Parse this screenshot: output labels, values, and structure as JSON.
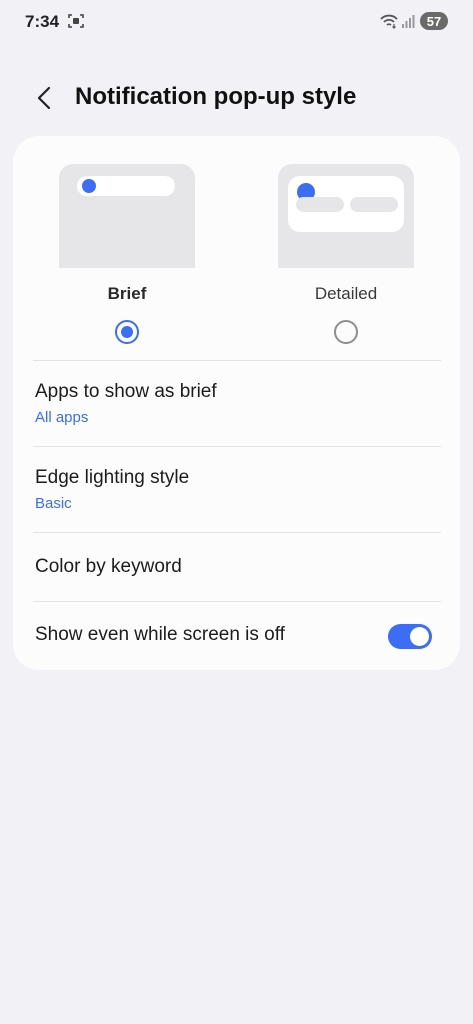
{
  "status_bar": {
    "time": "7:34",
    "battery": "57"
  },
  "header": {
    "title": "Notification pop-up style"
  },
  "styles": [
    {
      "label": "Brief",
      "selected": true
    },
    {
      "label": "Detailed",
      "selected": false
    }
  ],
  "settings": {
    "apps_brief": {
      "title": "Apps to show as brief",
      "value": "All apps"
    },
    "edge_lighting": {
      "title": "Edge lighting style",
      "value": "Basic"
    },
    "color_keyword": {
      "title": "Color by keyword"
    },
    "screen_off": {
      "title": "Show even while screen is off",
      "enabled": true
    }
  },
  "colors": {
    "accent": "#3b6df5",
    "background": "#f2f1f6",
    "card": "#fcfcfd"
  }
}
